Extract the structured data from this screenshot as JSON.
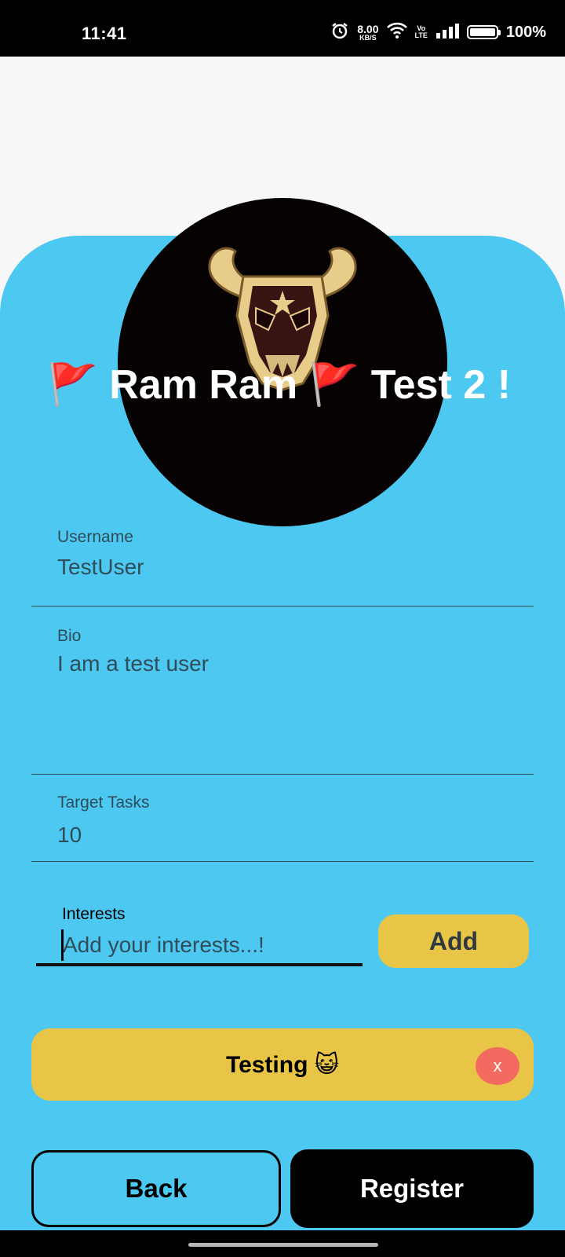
{
  "status_bar": {
    "time": "11:41",
    "net_speed_value": "8.00",
    "net_speed_unit": "KB/S",
    "volte_top": "Vo",
    "volte_bottom": "LTE",
    "battery": "100%",
    "icons": [
      "alarm-icon",
      "wifi-icon",
      "volte-icon",
      "signal-icon",
      "battery-icon"
    ]
  },
  "profile": {
    "avatar_icon": "black-bull-emblem-icon",
    "title": "🚩 Ram Ram 🚩 Test 2 !"
  },
  "form": {
    "username": {
      "label": "Username",
      "value": "TestUser"
    },
    "bio": {
      "label": "Bio",
      "value": "I am a test user"
    },
    "target_tasks": {
      "label": "Target Tasks",
      "value": "10"
    },
    "interests": {
      "label": "Interests",
      "placeholder": "Add your interests...!",
      "value": ""
    },
    "add_label": "Add"
  },
  "interest_chips": [
    {
      "label": "Testing 😺",
      "remove_label": "x"
    }
  ],
  "actions": {
    "back_label": "Back",
    "register_label": "Register"
  },
  "colors": {
    "card": "#4dc8f1",
    "accent": "#e8c547",
    "remove": "#f26a60",
    "primary_button": "#000000"
  }
}
